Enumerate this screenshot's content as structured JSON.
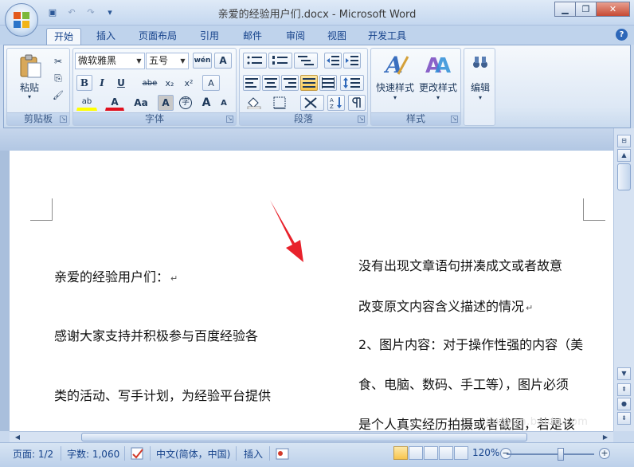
{
  "window": {
    "title": "亲爱的经验用户们.docx - Microsoft Word",
    "minimize": "▁",
    "restore": "❐",
    "close": "✕"
  },
  "qat": {
    "save_icon": "▣",
    "undo_icon": "↶",
    "redo_icon": "↷",
    "more_icon": "▾"
  },
  "tabs": [
    "开始",
    "插入",
    "页面布局",
    "引用",
    "邮件",
    "审阅",
    "视图",
    "开发工具"
  ],
  "help": "?",
  "ribbon": {
    "clipboard": {
      "label": "剪贴板",
      "paste": "粘贴",
      "paste_arrow": "▾",
      "cut": "✂",
      "copy": "⎘",
      "format_painter": "🖌"
    },
    "font": {
      "label": "字体",
      "font_name": "微软雅黑",
      "font_size": "五号",
      "pinyin": "wén",
      "char_border": "A",
      "bold": "B",
      "italic": "I",
      "underline": "U",
      "strike": "abe",
      "subscript": "x₂",
      "superscript": "x²",
      "clear_format": "A",
      "highlight": "ab",
      "font_color": "A",
      "change_case": "Aa",
      "char_shading": "A",
      "enclose": "字",
      "grow": "A",
      "shrink": "A"
    },
    "paragraph": {
      "label": "段落"
    },
    "styles": {
      "label": "样式",
      "quick": "快速样式",
      "change": "更改样式"
    },
    "editing": {
      "label": "编辑",
      "arrow": "▾"
    }
  },
  "document": {
    "left_column": [
      "亲爱的经验用户们：",
      "感谢大家支持并积极参与百度经验各",
      "类的活动、写手计划，为经验平台提供"
    ],
    "right_column": [
      "没有出现文章语句拼凑成文或者故意",
      "改变原文内容含义描述的情况",
      "2、图片内容：对于操作性强的内容（美",
      "食、电脑、数码、手工等），图片必须",
      "是个人真实经历拍摄或者截图，若是该"
    ],
    "para_mark": "↵"
  },
  "watermark": "jingyan.baidu.com",
  "status": {
    "page": "页面: 1/2",
    "words": "字数: 1,060",
    "language": "中文(简体，中国)",
    "mode": "插入",
    "zoom": "120%",
    "zoom_minus": "−",
    "zoom_plus": "+"
  },
  "colors": {
    "accent": "#15428b",
    "highlight_yellow": "#ffff00",
    "font_red": "#e0101e",
    "arrow_red": "#e8212b"
  }
}
